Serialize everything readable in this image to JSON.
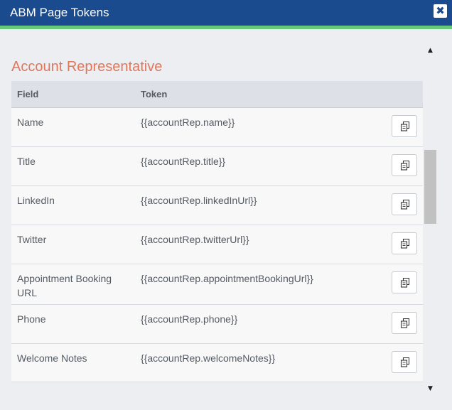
{
  "window": {
    "title": "ABM Page Tokens",
    "close_icon": "close-icon",
    "close_glyph": "✖"
  },
  "section": {
    "title": "Account Representative"
  },
  "table": {
    "columns": [
      "Field",
      "Token"
    ],
    "rows": [
      {
        "field": "Name",
        "token": "{{accountRep.name}}"
      },
      {
        "field": "Title",
        "token": "{{accountRep.title}}"
      },
      {
        "field": "LinkedIn",
        "token": "{{accountRep.linkedInUrl}}"
      },
      {
        "field": "Twitter",
        "token": "{{accountRep.twitterUrl}}"
      },
      {
        "field": "Appointment Booking URL",
        "token": "{{accountRep.appointmentBookingUrl}}"
      },
      {
        "field": "Phone",
        "token": "{{accountRep.phone}}"
      },
      {
        "field": "Welcome Notes",
        "token": "{{accountRep.welcomeNotes}}"
      }
    ],
    "row_action_icon": "copy-icon"
  },
  "scrollbar": {
    "up_glyph": "▲",
    "down_glyph": "▼"
  },
  "colors": {
    "titlebar": "#1a4b8e",
    "accent_bar": "#65c87b",
    "section_title": "#e0775a"
  }
}
